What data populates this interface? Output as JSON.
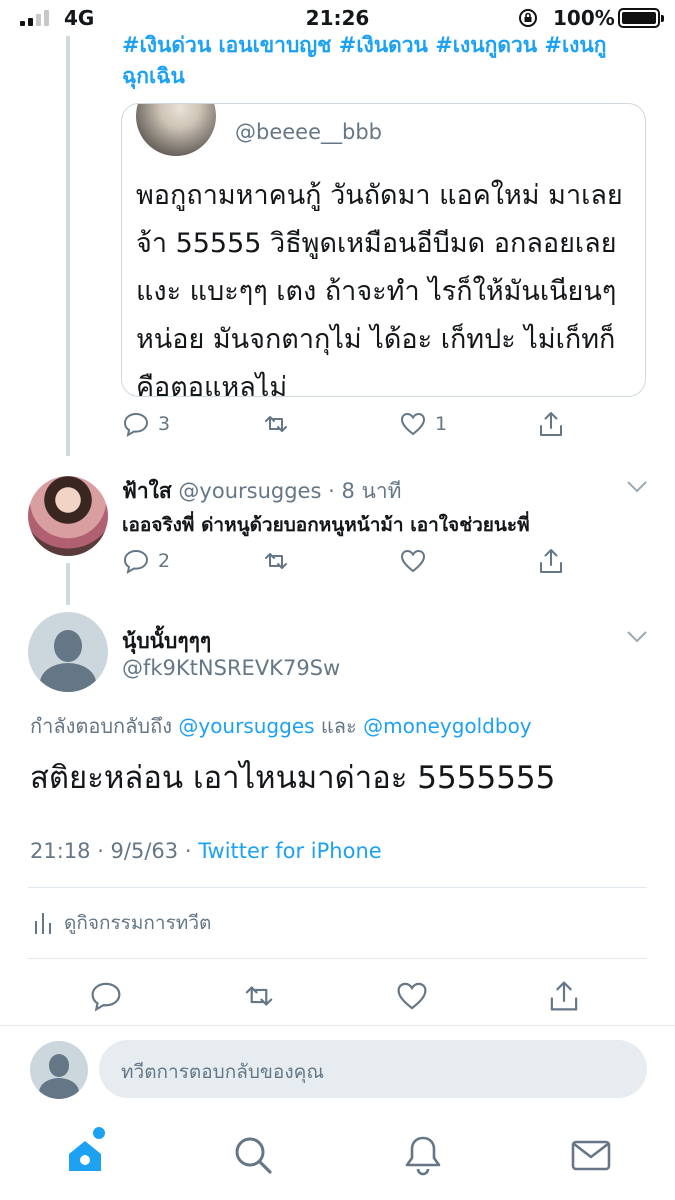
{
  "status_bar": {
    "carrier_network": "4G",
    "time": "21:26",
    "battery_percent": "100%",
    "battery_level": 1.0
  },
  "quoted_context": {
    "hashtags": "#เงินด่วน เอนเขาบญช #เงินดวน #เงนกูดวน #เงนกู ฉุกเฉิน",
    "card": {
      "handle": "@beeee__bbb",
      "text": "พอกูถามหาคนกู้ วันถัดมา แอคใหม่ มาเลยจ้า 55555 วิธีพูดเหมือนอีบีมด อกลอยเลยแงะ แบะๆๆ เตง ถ้าจะทำ ไรก็ให้มันเนียนๆหน่อย มันจกตากุไม่ ได้อะ เก็ทปะ ไม่เก็ทก็คือตอแหลไม่"
    },
    "actions": {
      "reply_count": "3",
      "like_count": "1"
    }
  },
  "reply_tweet": {
    "name": "ฟ้าใส",
    "handle_time": "@yoursugges · 8 นาที",
    "text": "เออจริงพี่ ด่าหนูด้วยบอกหนูหน้าม้า เอาใจช่วยนะพี่",
    "actions": {
      "reply_count": "2"
    }
  },
  "main_tweet": {
    "name": "นุ้บนั้บๆๆๆ",
    "handle": "@fk9KtNSREVK79Sw",
    "replying_prefix": "กำลังตอบกลับถึง",
    "replying_user_1": "@yoursugges",
    "replying_and": "และ",
    "replying_user_2": "@moneygoldboy",
    "text": "สติยะหล่อน เอาไหนมาด่าอะ 5555555",
    "time_date": "21:18 · 9/5/63 ·",
    "source": "Twitter for iPhone",
    "activity_label": "ดูกิจกรรมการทวีต"
  },
  "compose": {
    "placeholder": "ทวีตการตอบกลับของคุณ"
  },
  "colors": {
    "accent": "#1da1f2",
    "secondary_text": "#657786",
    "divider": "#e1e8ed"
  },
  "icons": {
    "reply": "reply-icon",
    "retweet": "retweet-icon",
    "like": "heart-icon",
    "share": "share-icon",
    "home": "home-icon",
    "search": "search-icon",
    "notifications": "bell-icon",
    "messages": "mail-icon"
  }
}
